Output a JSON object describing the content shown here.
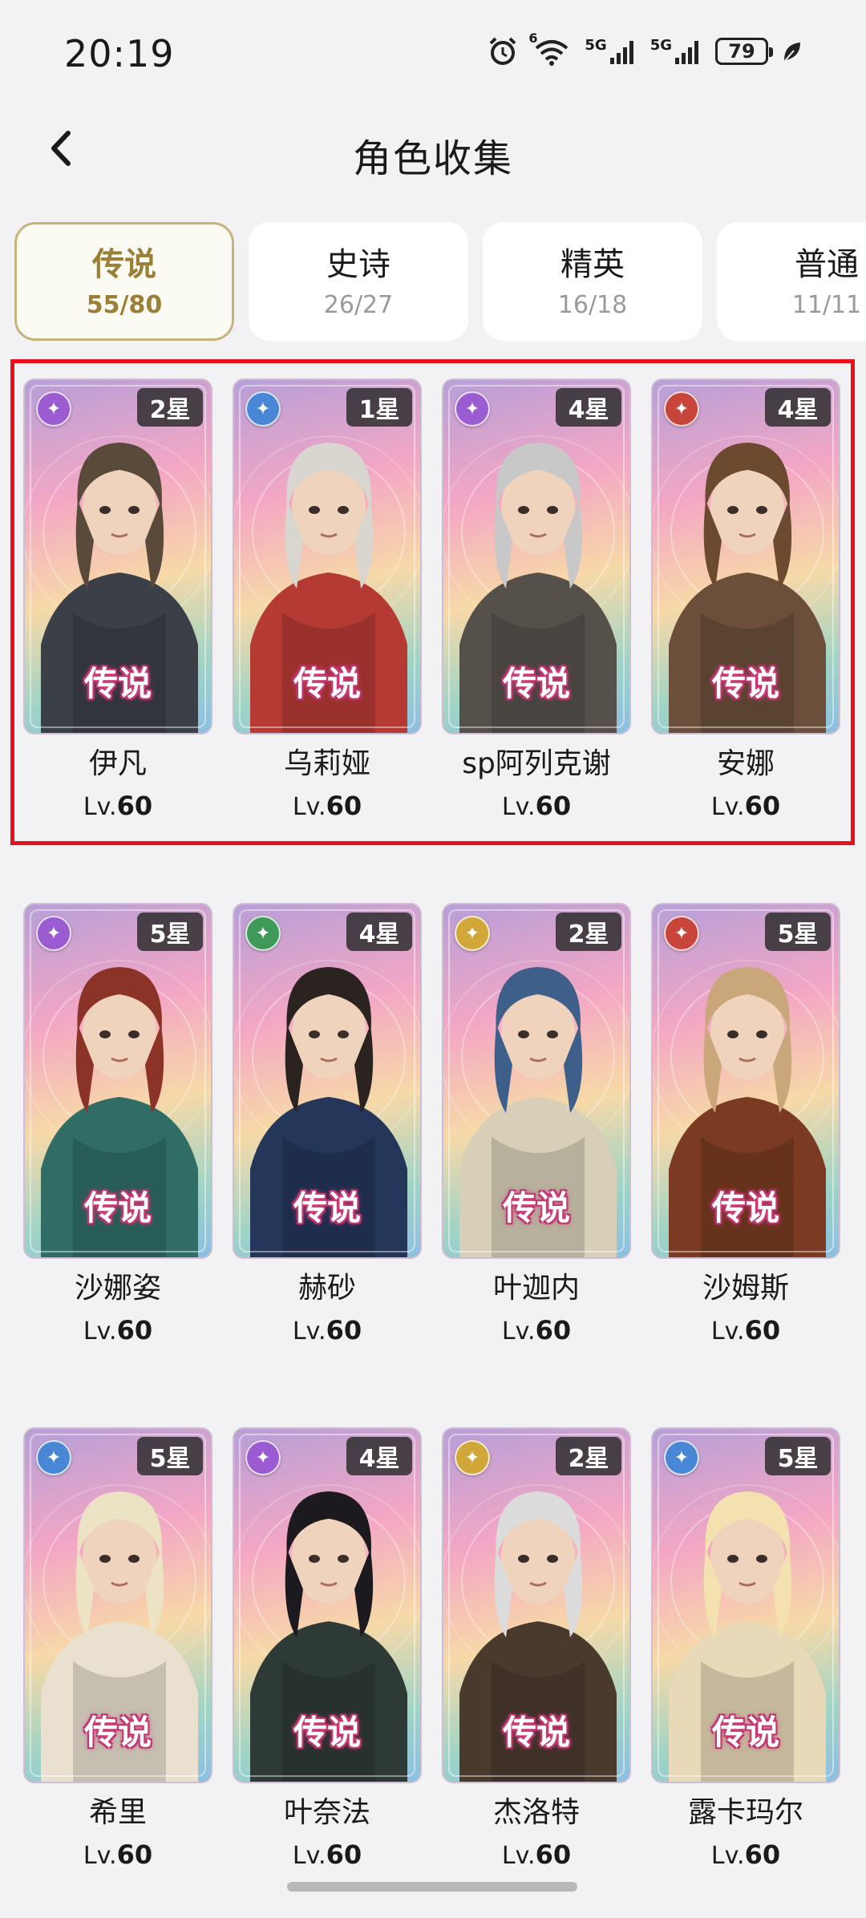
{
  "status_bar": {
    "time": "20:19",
    "battery": "79",
    "network_1": "5G",
    "network_2": "5G",
    "wifi_badge": "6"
  },
  "header": {
    "title": "角色收集",
    "back_icon": "chevron-left-icon"
  },
  "tabs": [
    {
      "label": "传说",
      "count": "55/80",
      "active": true
    },
    {
      "label": "史诗",
      "count": "26/27",
      "active": false
    },
    {
      "label": "精英",
      "count": "16/18",
      "active": false
    },
    {
      "label": "普通",
      "count": "11/11",
      "active": false
    }
  ],
  "level_prefix": "Lv.",
  "characters": [
    {
      "name": "伊凡",
      "stars": "2星",
      "rarity": "传说",
      "level": "60",
      "element": "purple-swirl",
      "element_color": "#9b5bd1"
    },
    {
      "name": "乌莉娅",
      "stars": "1星",
      "rarity": "传说",
      "level": "60",
      "element": "blue-cross",
      "element_color": "#4a86d6"
    },
    {
      "name": "sp阿列克谢",
      "stars": "4星",
      "rarity": "传说",
      "level": "60",
      "element": "purple-swirl",
      "element_color": "#9b5bd1"
    },
    {
      "name": "安娜",
      "stars": "4星",
      "rarity": "传说",
      "level": "60",
      "element": "red-sword",
      "element_color": "#c8453c"
    },
    {
      "name": "沙娜姿",
      "stars": "5星",
      "rarity": "传说",
      "level": "60",
      "element": "purple-swirl",
      "element_color": "#9b5bd1"
    },
    {
      "name": "赫砂",
      "stars": "4星",
      "rarity": "传说",
      "level": "60",
      "element": "green-shield",
      "element_color": "#3f9a5a"
    },
    {
      "name": "叶迦内",
      "stars": "2星",
      "rarity": "传说",
      "level": "60",
      "element": "gold-star",
      "element_color": "#d2a73a"
    },
    {
      "name": "沙姆斯",
      "stars": "5星",
      "rarity": "传说",
      "level": "60",
      "element": "red-sword",
      "element_color": "#c8453c"
    },
    {
      "name": "希里",
      "stars": "5星",
      "rarity": "传说",
      "level": "60",
      "element": "blue-cross",
      "element_color": "#4a86d6"
    },
    {
      "name": "叶奈法",
      "stars": "4星",
      "rarity": "传说",
      "level": "60",
      "element": "purple-swirl",
      "element_color": "#9b5bd1"
    },
    {
      "name": "杰洛特",
      "stars": "2星",
      "rarity": "传说",
      "level": "60",
      "element": "gold-star",
      "element_color": "#d2a73a"
    },
    {
      "name": "露卡玛尔",
      "stars": "5星",
      "rarity": "传说",
      "level": "60",
      "element": "blue-cross",
      "element_color": "#4a86d6"
    }
  ],
  "colors": {
    "accent_gold": "#9a7f37",
    "highlight_red": "#e8101a"
  }
}
